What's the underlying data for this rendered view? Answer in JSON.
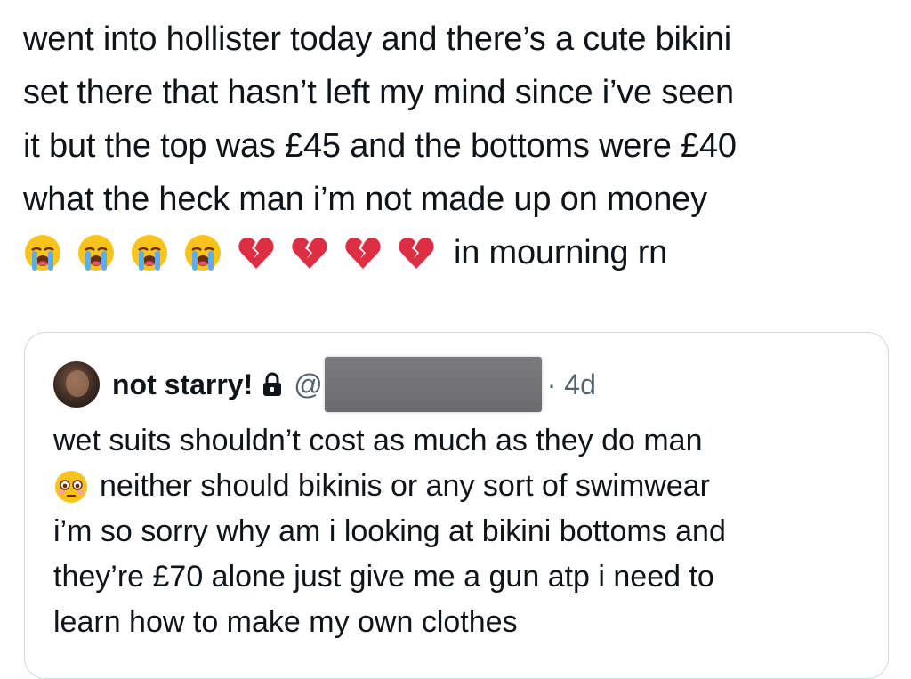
{
  "tweet": {
    "lines": [
      "went into hollister today and there’s a cute bikini",
      "set there that hasn’t left my mind since i’ve seen",
      "it but the top was £45 and the bottoms were £40",
      "what the heck man i’m not made up on money"
    ],
    "emoji_line": {
      "emojis": [
        "loudly-crying-face",
        "loudly-crying-face",
        "loudly-crying-face",
        "loudly-crying-face",
        "broken-heart",
        "broken-heart",
        "broken-heart",
        "broken-heart"
      ],
      "tail_text": "in mourning rn"
    }
  },
  "quoted_tweet": {
    "display_name": "not starry!",
    "handle_prefix": "@",
    "time": "· 4d",
    "lines": [
      "wet suits shouldn’t cost as much as they do man",
      "neither should bikinis or any sort of swimwear",
      "i’m so sorry why am i looking at bikini bottoms and",
      "they’re £70 alone just give me a gun atp i need to",
      "learn how to make my own clothes"
    ],
    "emoji_before_line_2": "flushed-face"
  },
  "colors": {
    "text": "#0f1419",
    "secondary": "#536471",
    "border": "#cfd9de"
  }
}
